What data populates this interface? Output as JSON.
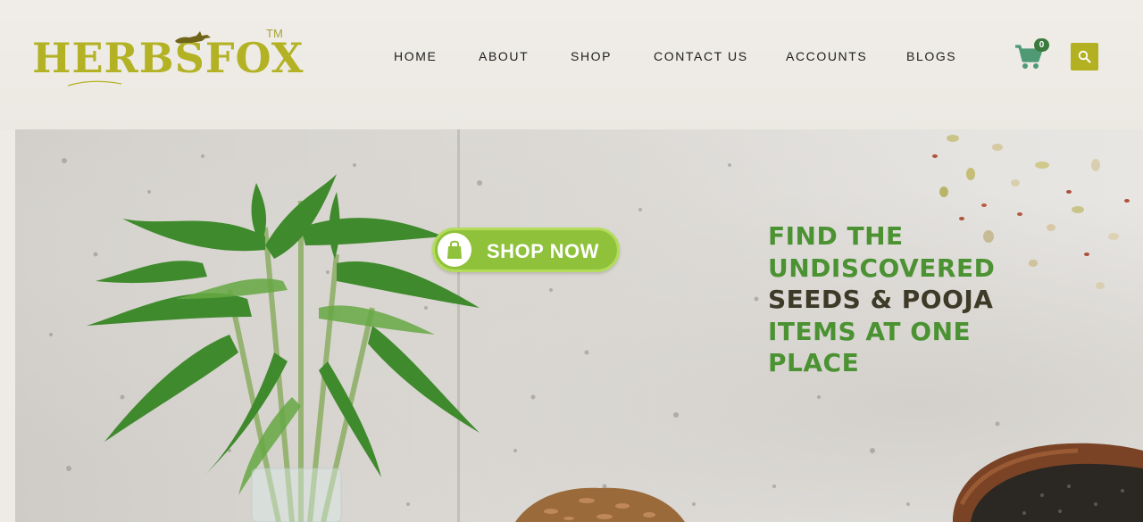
{
  "brand": {
    "name": "HERBSFOX",
    "trademark": "TM"
  },
  "nav": {
    "items": [
      {
        "label": "HOME"
      },
      {
        "label": "ABOUT"
      },
      {
        "label": "SHOP"
      },
      {
        "label": "CONTACT US"
      },
      {
        "label": "ACCOUNTS"
      },
      {
        "label": "BLOGS"
      }
    ]
  },
  "cart": {
    "count": "0",
    "icon": "cart-icon"
  },
  "search": {
    "icon": "search-icon"
  },
  "hero": {
    "cta_label": "SHOP NOW",
    "cta_icon": "shopping-bag-icon",
    "tagline": {
      "line1": "FIND THE",
      "line2": "UNDISCOVERED",
      "line3": "SEEDS & POOJA",
      "line4": "ITEMS AT ONE",
      "line5": "PLACE"
    }
  },
  "colors": {
    "brand_olive": "#b3b224",
    "cta_green": "#8fc23a",
    "cart_green": "#4f9a74",
    "badge_green": "#3b7a3d",
    "tagline_green": "#4b9232",
    "tagline_dark": "#3d3a28"
  }
}
